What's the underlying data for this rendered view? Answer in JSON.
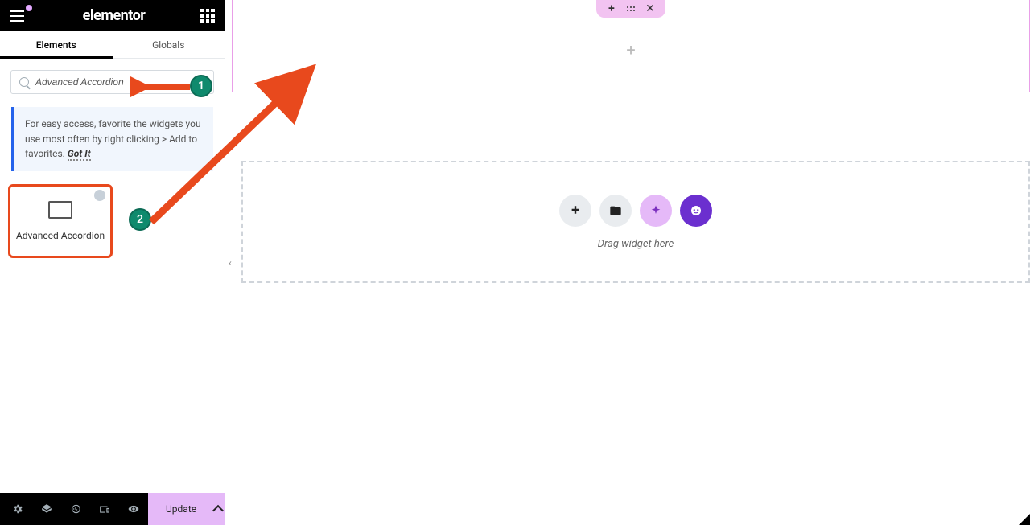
{
  "brand": "elementor",
  "tabs": {
    "elements": "Elements",
    "globals": "Globals"
  },
  "search": {
    "value": "Advanced Accordion"
  },
  "tip": {
    "text": "For easy access, favorite the widgets you use most often by right clicking > Add to favorites.",
    "gotit": "Got It"
  },
  "widgets": {
    "advanced_accordion": {
      "label": "Advanced Accordion"
    }
  },
  "footer": {
    "update": "Update"
  },
  "canvas": {
    "drag_hint": "Drag widget here"
  },
  "annotations": {
    "m1": "1",
    "m2": "2"
  }
}
